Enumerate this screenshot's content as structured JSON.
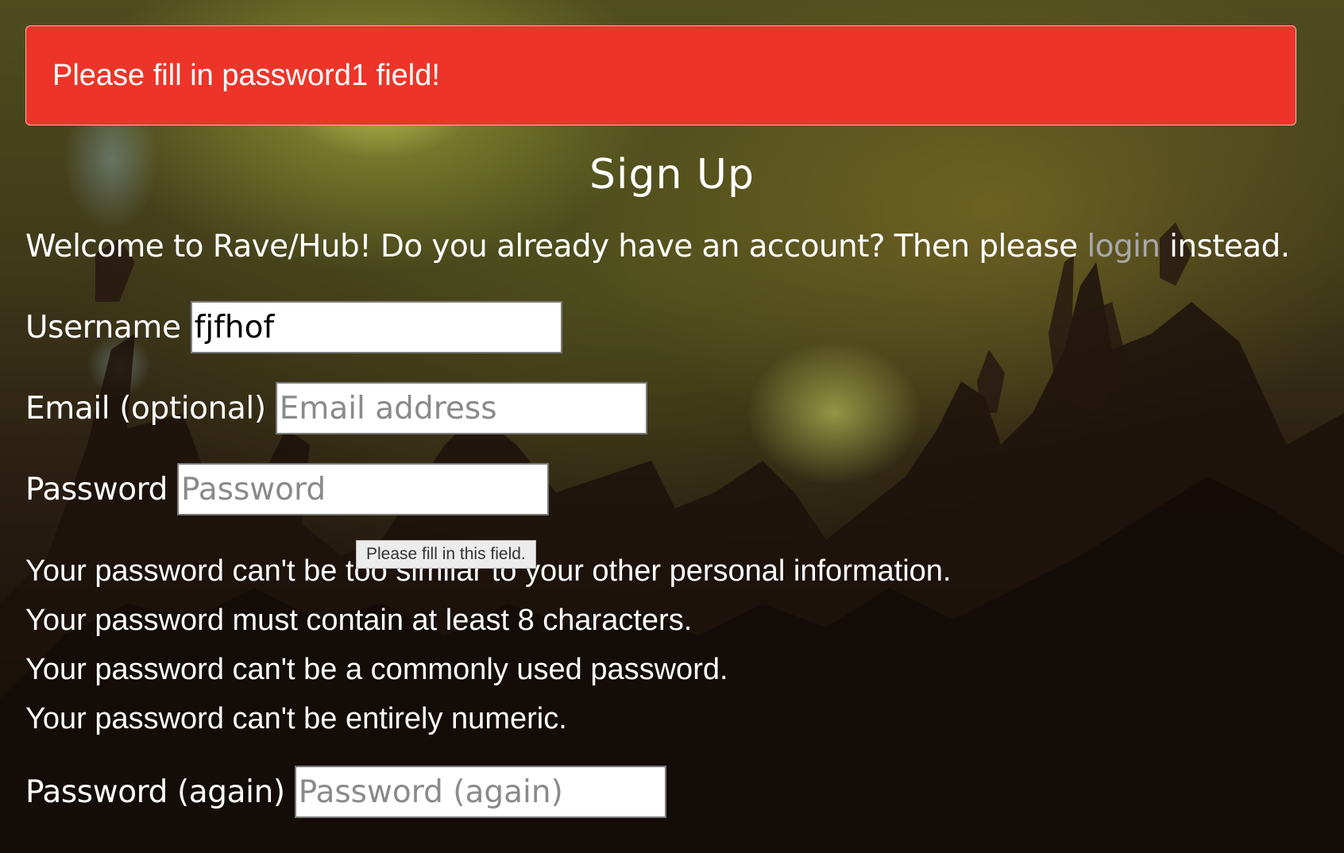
{
  "alert": {
    "message": "Please fill in password1 field!"
  },
  "page": {
    "title": "Sign Up",
    "welcome_before": "Welcome to Rave/Hub! Do you already have an account? Then please ",
    "login_link": "login",
    "welcome_after": " instead."
  },
  "form": {
    "username": {
      "label": "Username",
      "value": "fjfhof",
      "placeholder": ""
    },
    "email": {
      "label": "Email (optional)",
      "value": "",
      "placeholder": "Email address"
    },
    "password1": {
      "label": "Password",
      "value": "",
      "placeholder": "Password"
    },
    "password2": {
      "label": "Password (again)",
      "value": "",
      "placeholder": "Password (again)"
    }
  },
  "validation_tooltip": "Please fill in this field.",
  "password_help": [
    "Your password can't be too similar to your other personal information.",
    "Your password must contain at least 8 characters.",
    "Your password can't be a commonly used password.",
    "Your password can't be entirely numeric."
  ],
  "colors": {
    "alert_background": "#ec3528",
    "link": "#a8a8a8",
    "text": "#ffffff"
  },
  "background": "concert crowd silhouettes"
}
